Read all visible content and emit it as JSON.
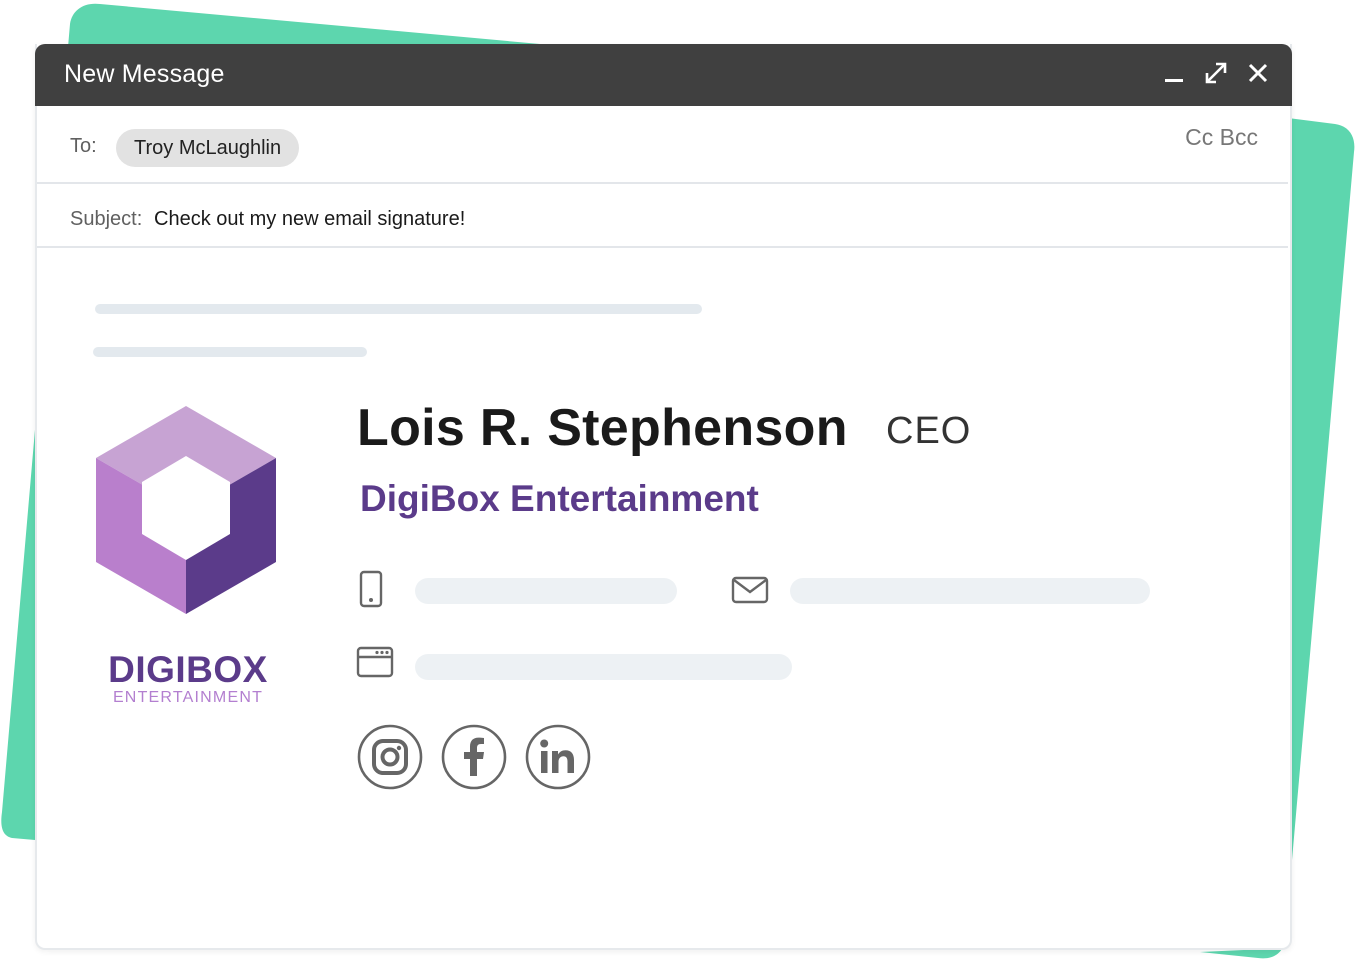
{
  "window": {
    "title": "New Message",
    "controls": [
      "minimize-icon",
      "expand-icon",
      "close-icon"
    ]
  },
  "recipients": {
    "to_label": "To:",
    "to_chip": "Troy McLaughlin",
    "cc_bcc": "Cc Bcc"
  },
  "subject": {
    "label": "Subject:",
    "value": "Check out my new email signature!"
  },
  "signature": {
    "name": "Lois R. Stephenson",
    "title": "CEO",
    "company": "DigiBox Entertainment",
    "logo_text_main": "DIGIBOX",
    "logo_text_sub": "ENTERTAINMENT",
    "contact_icons": [
      "phone-icon",
      "email-icon",
      "website-icon"
    ],
    "social_icons": [
      "instagram-icon",
      "facebook-icon",
      "linkedin-icon"
    ]
  },
  "colors": {
    "titlebar": "#404040",
    "accent_green": "#5dd6ae",
    "brand_purple": "#5b3b8a",
    "brand_light_purple": "#b37fd0",
    "placeholder": "#e3e9ee"
  }
}
